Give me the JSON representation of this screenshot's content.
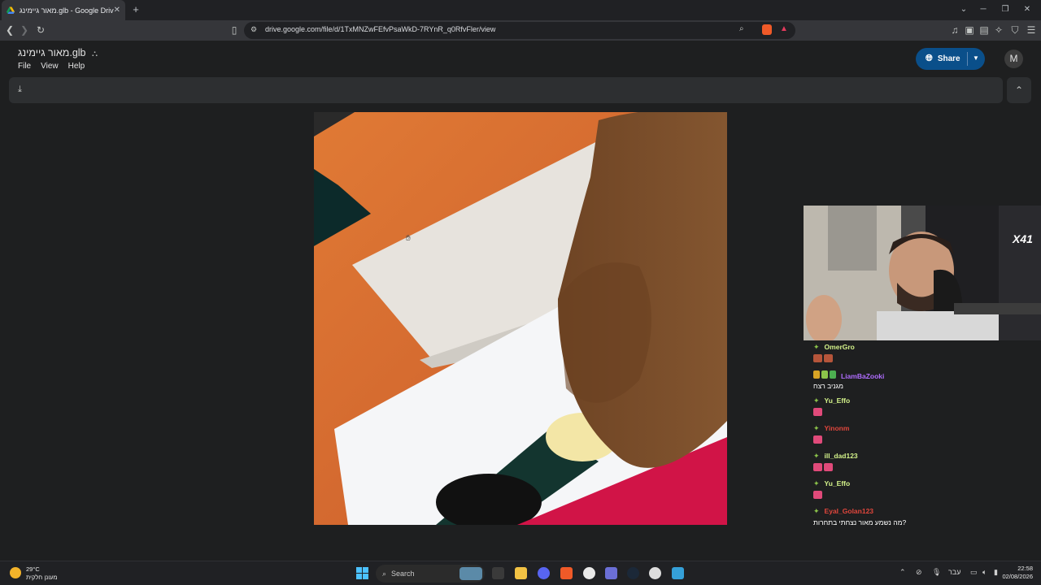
{
  "browser": {
    "tab_title": "מאור גיימינג.glb - Google Drive",
    "url": "drive.google.com/file/d/1TxMNZwFEfvPsaWkD-7RYnR_q0RfvFler/view"
  },
  "drive": {
    "doc_title": "מאור גיימינג.glb",
    "menu": [
      "File",
      "View",
      "Help"
    ],
    "share_label": "Share",
    "avatar_letter": "M"
  },
  "stream": {
    "badge": "X41",
    "chat": [
      {
        "user": "OmerGro",
        "color": "#d4f38a",
        "msg": ""
      },
      {
        "user": "LiamBaZooki",
        "color": "#b06dff",
        "msg": "מגניב רצח"
      },
      {
        "user": "Yu_Effo",
        "color": "#d4f38a",
        "msg": ""
      },
      {
        "user": "Yinonm",
        "color": "#e0463c",
        "msg": ""
      },
      {
        "user": "ill_dad123",
        "color": "#d4f38a",
        "msg": ""
      },
      {
        "user": "Yu_Effo",
        "color": "#d4f38a",
        "msg": ""
      },
      {
        "user": "Eyal_Golan123",
        "color": "#e0463c",
        "msg": "מה נשמע מאור נצחתי בתחרות?"
      }
    ]
  },
  "taskbar": {
    "temperature": "29°C",
    "weather_desc": "מעונן חלקית",
    "search_label": "Search",
    "lang": "עבר",
    "time": "22:58",
    "date": "02/08/2026"
  }
}
